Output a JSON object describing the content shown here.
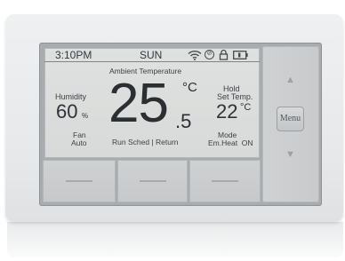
{
  "thermostat": {
    "status": {
      "time": "3:10PM",
      "day": "SUN",
      "icons": [
        "wifi-icon",
        "circle-icon",
        "lock-icon",
        "battery-icon"
      ]
    },
    "ambient_label": "Ambient Temperature",
    "temperature_whole": "25",
    "temperature_decimal": ".5",
    "temperature_unit": "°C",
    "humidity": {
      "label": "Humidity",
      "value": "60",
      "unit": "%"
    },
    "hold": {
      "label": "Hold",
      "set_label": "Set Temp.",
      "value": "22",
      "unit": "°C"
    },
    "fan": {
      "label": "Fan",
      "value": "Auto"
    },
    "mode": {
      "label": "Mode",
      "value": "Em.Heat  ON"
    },
    "schedule_text": "Run Sched | Return",
    "menu_label": "Menu",
    "up_icon": "up-arrow-icon",
    "down_icon": "down-arrow-icon",
    "soft_keys": [
      "",
      "",
      ""
    ]
  }
}
